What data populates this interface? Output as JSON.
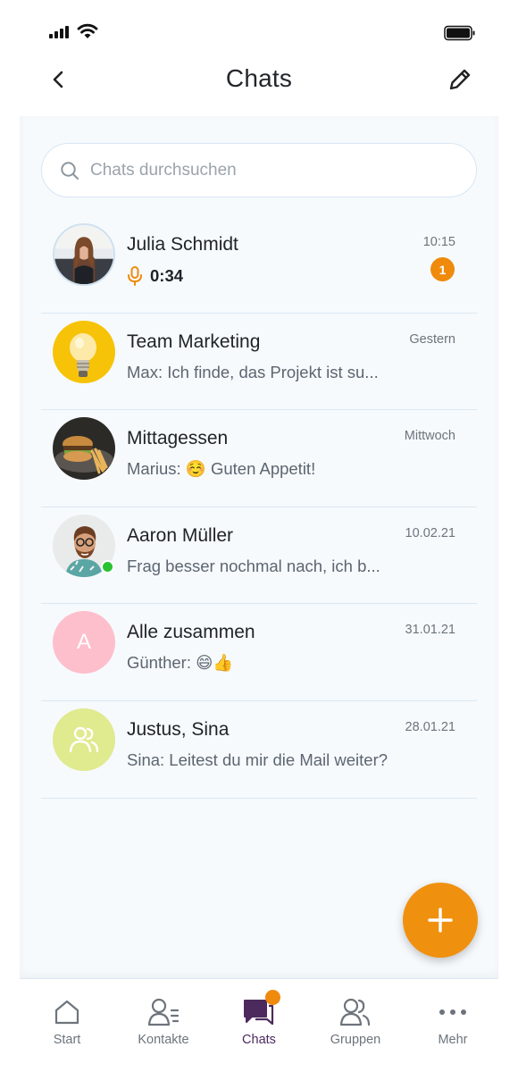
{
  "nav": {
    "title": "Chats"
  },
  "search": {
    "placeholder": "Chats durchsuchen"
  },
  "chats": [
    {
      "name": "Julia Schmidt",
      "preview": "0:34",
      "time": "10:15",
      "badge": "1",
      "avatar": "photo-portrait-woman"
    },
    {
      "name": "Team Marketing",
      "preview": "Max: Ich finde, das Projekt ist su...",
      "time": "Gestern",
      "avatar": "lightbulb"
    },
    {
      "name": "Mittagessen",
      "preview": "Marius: ☺️ Guten Appetit!",
      "time": "Mittwoch",
      "avatar": "photo-burger"
    },
    {
      "name": "Aaron Müller",
      "preview": "Frag besser nochmal nach, ich b...",
      "time": "10.02.21",
      "avatar": "photo-portrait-man",
      "online": true
    },
    {
      "name": "Alle zusammen",
      "preview": "Günther: 😄👍",
      "time": "31.01.21",
      "avatar_letter": "A"
    },
    {
      "name": "Justus, Sina",
      "preview": "Sina: Leitest du mir die Mail weiter?",
      "time": "28.01.21",
      "avatar": "group-icon"
    }
  ],
  "tabs": [
    {
      "label": "Start",
      "icon": "home-icon"
    },
    {
      "label": "Kontakte",
      "icon": "contacts-icon"
    },
    {
      "label": "Chats",
      "icon": "chats-icon",
      "active": true
    },
    {
      "label": "Gruppen",
      "icon": "groups-icon"
    },
    {
      "label": "Mehr",
      "icon": "more-icon"
    }
  ],
  "colors": {
    "accent": "#ef8a0d",
    "active_tab": "#4c2a5e",
    "online": "#29c231",
    "background": "#f6fafd"
  }
}
